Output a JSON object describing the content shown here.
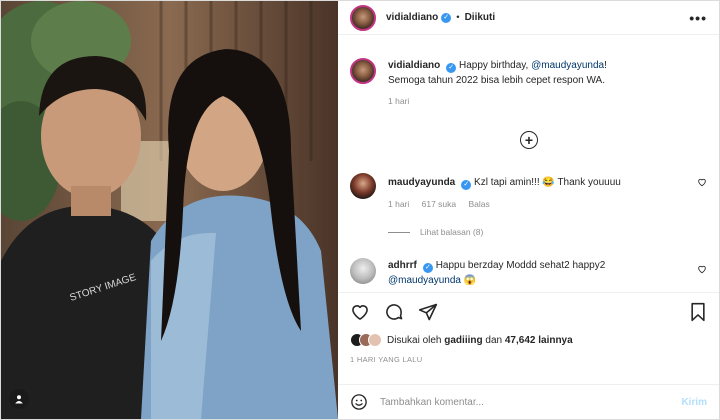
{
  "post": {
    "author": "vidialdiano",
    "follow_state": "Diikuti",
    "more_label": "•••"
  },
  "caption": {
    "author": "vidialdiano",
    "text_start": "Happy birthday, ",
    "mention": "@maudyayunda",
    "text_end": "!",
    "line2": "Semoga tahun 2022 bisa lebih cepet respon WA.",
    "time": "1 hari"
  },
  "comments": [
    {
      "author": "maudyayunda",
      "text": "Kzl tapi amin!!! 😂 Thank youuuu",
      "time": "1 hari",
      "likes": "617 suka",
      "reply": "Balas",
      "view_replies": "Lihat balasan (8)"
    },
    {
      "author": "adhrrf",
      "text": "Happu berzday Moddd sehat2 happy2",
      "mention": "@maudyayunda",
      "emoji": "😱"
    }
  ],
  "likes": {
    "prefix": "Disukai oleh",
    "liker": "gadiiing",
    "joiner": "dan",
    "others": "47,642 lainnya"
  },
  "timestamp": "1 HARI YANG LALU",
  "composer": {
    "placeholder": "Tambahkan komentar...",
    "post_label": "Kirim"
  },
  "icons": {
    "heart": "heart-icon",
    "comment": "comment-icon",
    "share": "share-icon",
    "bookmark": "bookmark-icon",
    "emoji": "emoji-icon",
    "add": "add-circle-icon",
    "user_tag": "user-tag-icon"
  },
  "colors": {
    "verified": "#3897f0",
    "link": "#00376b",
    "muted": "#8e8e8e",
    "post_button": "#b2dffc",
    "story_ring": "#c13584"
  }
}
